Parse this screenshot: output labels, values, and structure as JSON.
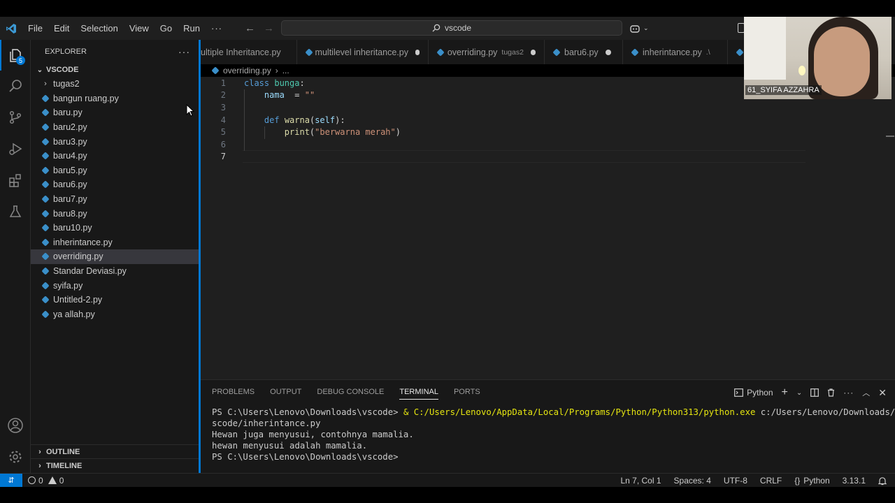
{
  "menu": {
    "items": [
      "File",
      "Edit",
      "Selection",
      "View",
      "Go",
      "Run"
    ],
    "more": "···"
  },
  "command_center": {
    "text": "vscode"
  },
  "activity_bar": {
    "explorer_badge": "5"
  },
  "explorer": {
    "title": "EXPLORER",
    "more": "···",
    "folder": "VSCODE",
    "items": [
      {
        "label": "tugas2",
        "type": "folder"
      },
      {
        "label": "bangun ruang.py",
        "type": "file"
      },
      {
        "label": "baru.py",
        "type": "file"
      },
      {
        "label": "baru2.py",
        "type": "file"
      },
      {
        "label": "baru3.py",
        "type": "file"
      },
      {
        "label": "baru4.py",
        "type": "file"
      },
      {
        "label": "baru5.py",
        "type": "file"
      },
      {
        "label": "baru6.py",
        "type": "file"
      },
      {
        "label": "baru7.py",
        "type": "file"
      },
      {
        "label": "baru8.py",
        "type": "file"
      },
      {
        "label": "baru10.py",
        "type": "file"
      },
      {
        "label": "inherintance.py",
        "type": "file"
      },
      {
        "label": "overriding.py",
        "type": "file",
        "selected": true
      },
      {
        "label": "Standar Deviasi.py",
        "type": "file"
      },
      {
        "label": "syifa.py",
        "type": "file"
      },
      {
        "label": "Untitled-2.py",
        "type": "file"
      },
      {
        "label": "ya allah.py",
        "type": "file"
      }
    ],
    "outline": "OUTLINE",
    "timeline": "TIMELINE"
  },
  "tabs": [
    {
      "label": "ultiple Inheritance.py",
      "desc": "",
      "dirty": false
    },
    {
      "label": "multilevel inheritance.py",
      "desc": "",
      "dirty": true
    },
    {
      "label": "overriding.py",
      "desc": "tugas2",
      "dirty": true
    },
    {
      "label": "baru6.py",
      "desc": "",
      "dirty": true
    },
    {
      "label": "inherintance.py",
      "desc": ".\\",
      "dirty": false
    }
  ],
  "breadcrumb": {
    "file": "overriding.py",
    "rest": "..."
  },
  "editor": {
    "line_numbers": [
      "1",
      "2",
      "3",
      "4",
      "5",
      "6",
      "7"
    ],
    "code": {
      "l1_kw": "class",
      "l1_name": "bunga",
      "l1_colon": ":",
      "l2_var": "nama",
      "l2_op": "  = ",
      "l2_str": "\"\"",
      "l4_kw": "def",
      "l4_fn": "warna",
      "l4_open": "(",
      "l4_param": "self",
      "l4_close": "):",
      "l5_fn": "print",
      "l5_open": "(",
      "l5_str": "\"berwarna merah\"",
      "l5_close": ")"
    }
  },
  "panel": {
    "tabs": [
      "PROBLEMS",
      "OUTPUT",
      "DEBUG CONSOLE",
      "TERMINAL",
      "PORTS"
    ],
    "active_tab": "TERMINAL",
    "terminal_profile": "Python",
    "terminal": {
      "prompt1": "PS C:\\Users\\Lenovo\\Downloads\\vscode> ",
      "cmd_amp": "& ",
      "cmd_exe": "C:/Users/Lenovo/AppData/Local/Programs/Python/Python313/python.exe",
      "cmd_arg1": " c:/Users/Lenovo/Downloads/v",
      "cmd_arg2": "scode/inherintance.py",
      "out1": "Hewan juga menyusui, contohnya mamalia.",
      "out2": "hewan menyusui adalah mamalia.",
      "prompt2": "PS C:\\Users\\Lenovo\\Downloads\\vscode>"
    }
  },
  "statusbar": {
    "errors": "0",
    "warnings": "0",
    "position": "Ln 7, Col 1",
    "spaces": "Spaces: 4",
    "encoding": "UTF-8",
    "eol": "CRLF",
    "language": "Python",
    "version": "3.13.1"
  },
  "webcam": {
    "name": "61_SYIFA AZZAHRA"
  },
  "colors": {
    "accent": "#0078d4",
    "editor_bg": "#1f1f1f",
    "sidebar_bg": "#181818"
  }
}
